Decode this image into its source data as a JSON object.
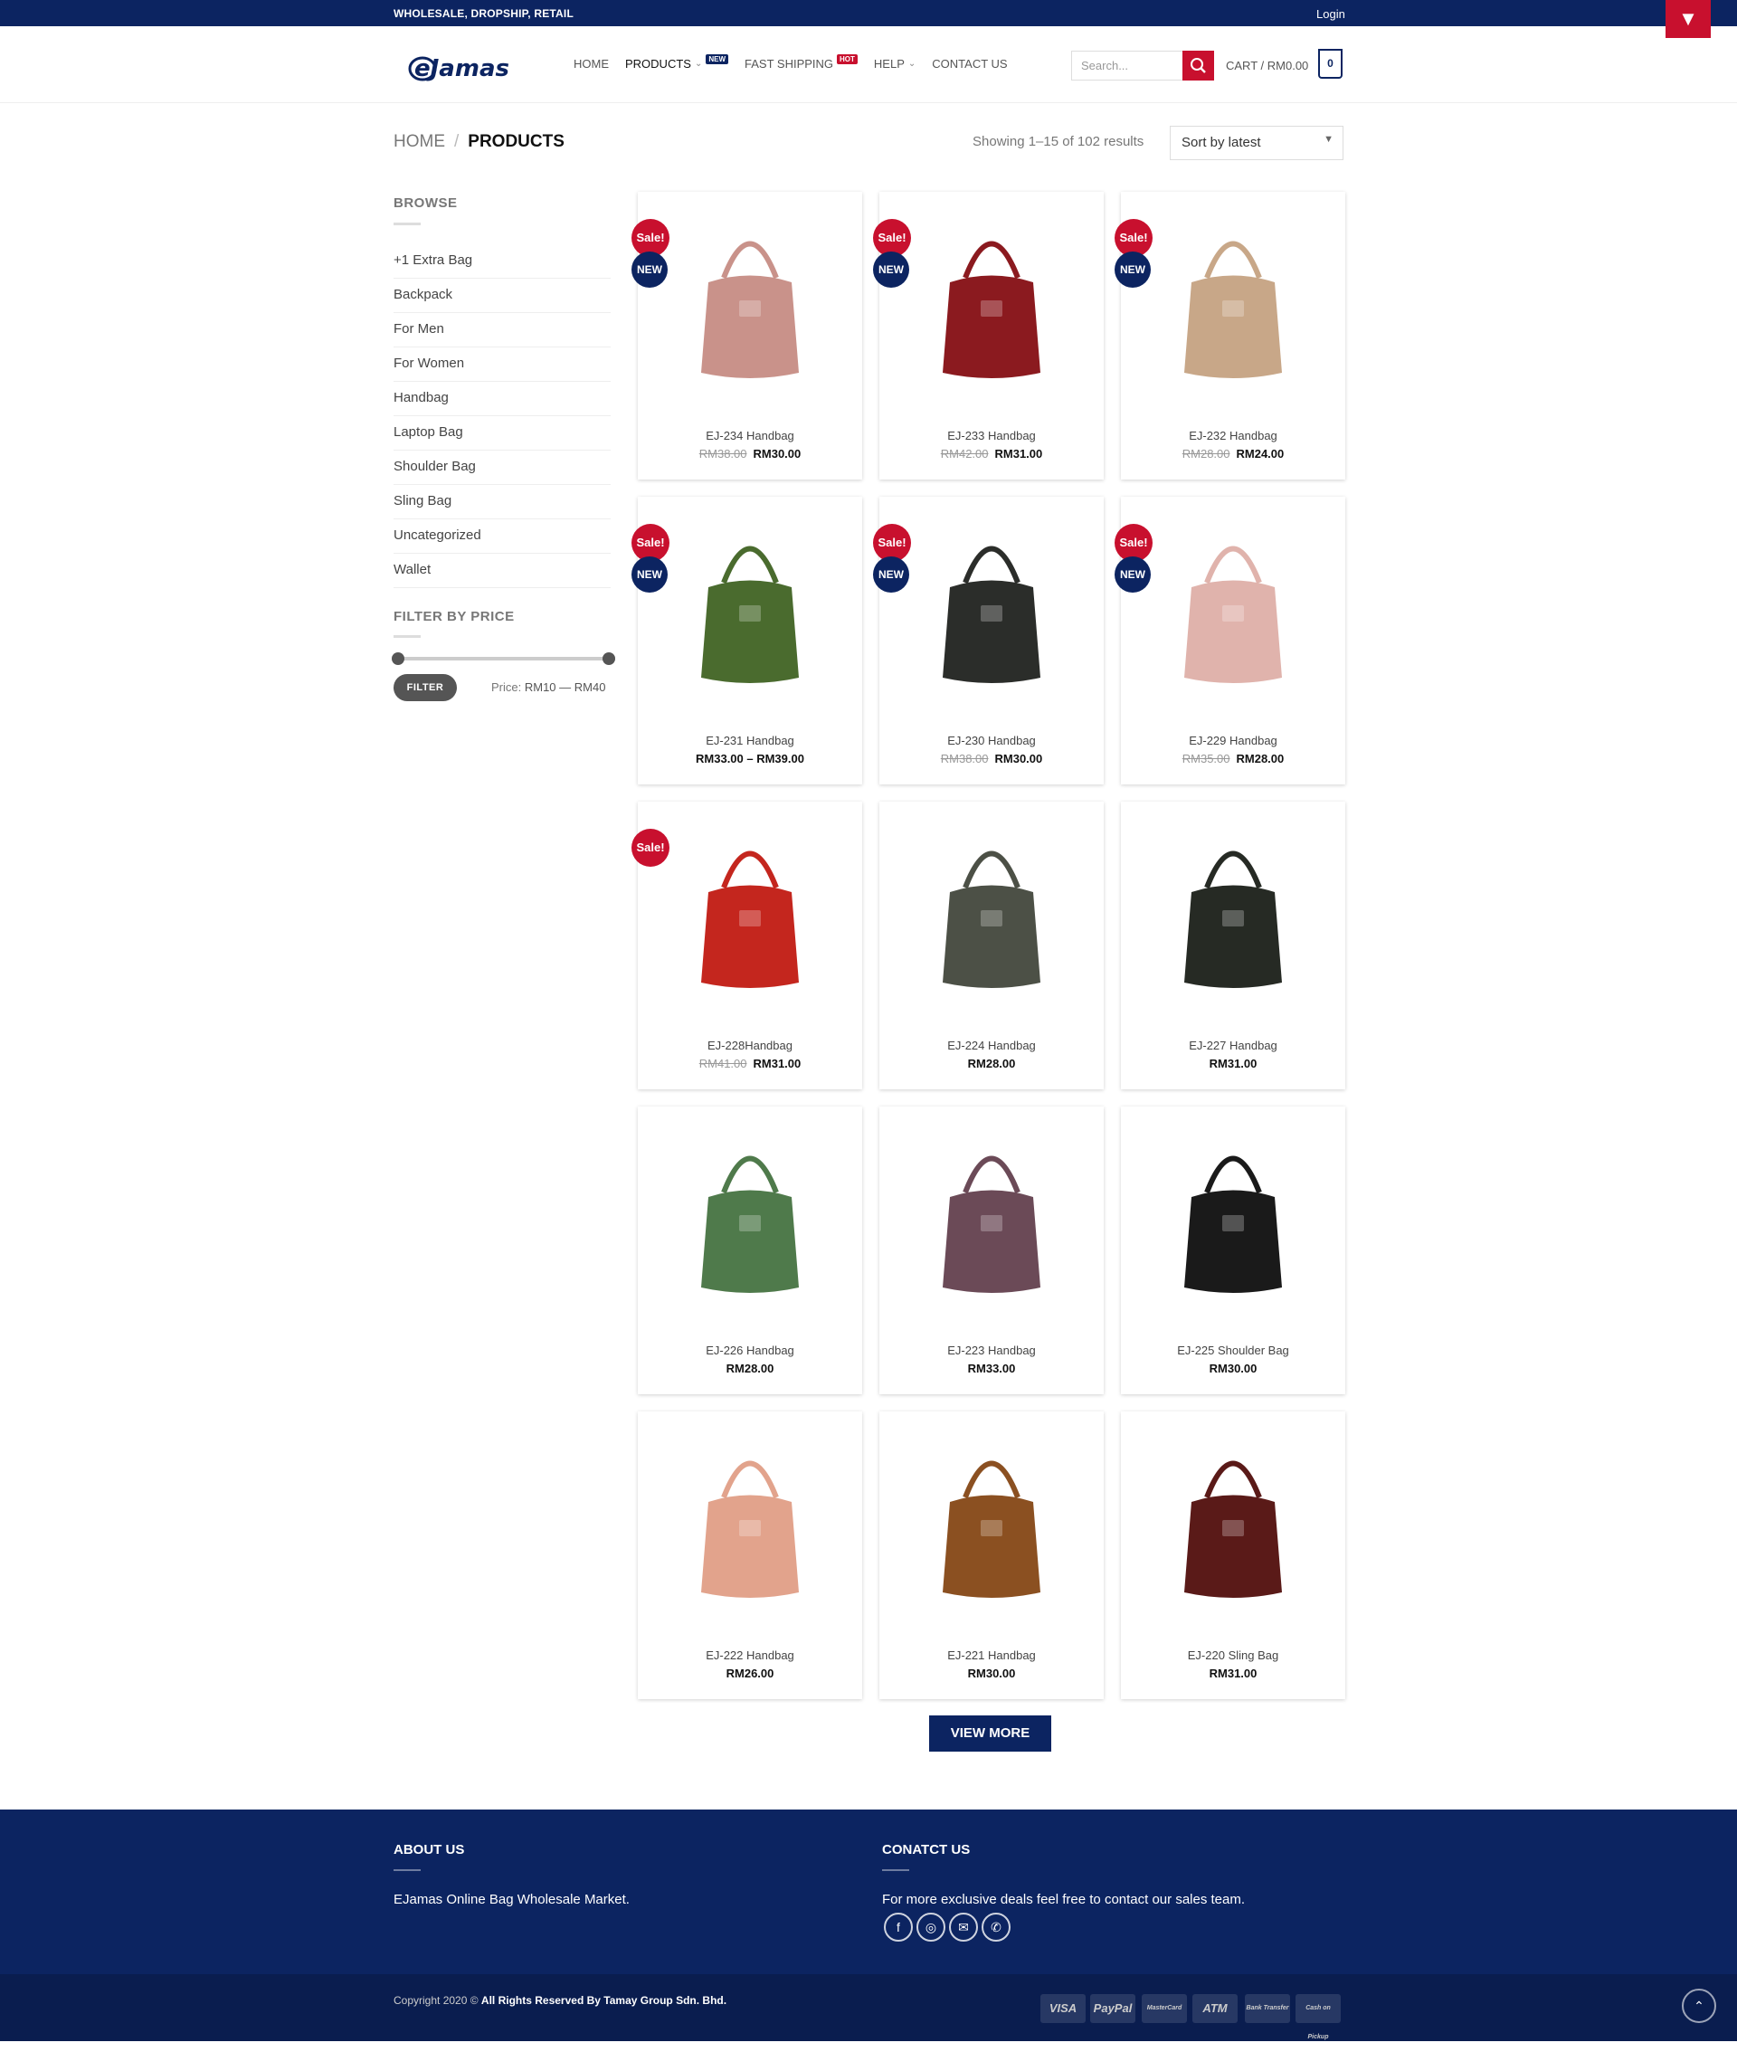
{
  "topbar": {
    "tagline": "WHOLESALE, DROPSHIP, RETAIL",
    "login": "Login",
    "corner_icon": "▼"
  },
  "header": {
    "logo_text": "eJamas",
    "nav": [
      {
        "label": "HOME",
        "chevron": false,
        "badge": ""
      },
      {
        "label": "PRODUCTS",
        "chevron": true,
        "badge": "NEW"
      },
      {
        "label": "FAST SHIPPING",
        "chevron": false,
        "badge": "HOT"
      },
      {
        "label": "HELP",
        "chevron": true,
        "badge": ""
      },
      {
        "label": "CONTACT US",
        "chevron": false,
        "badge": ""
      }
    ],
    "search_placeholder": "Search...",
    "cart_label": "CART / RM0.00",
    "cart_count": "0"
  },
  "breadcrumb": {
    "home": "HOME",
    "separator": "/",
    "current": "PRODUCTS"
  },
  "results": {
    "showing": "Showing 1–15 of 102 results",
    "sort": "Sort by latest"
  },
  "sidebar": {
    "browse_title": "BROWSE",
    "categories": [
      "+1 Extra Bag",
      "Backpack",
      "For Men",
      "For Women",
      "Handbag",
      "Laptop Bag",
      "Shoulder Bag",
      "Sling Bag",
      "Uncategorized",
      "Wallet"
    ],
    "filter_title": "FILTER BY PRICE",
    "filter_button": "FILTER",
    "price_label": "Price:",
    "price_range": "RM10 — RM40"
  },
  "products": [
    {
      "name": "EJ-234 Handbag",
      "old": "RM38.00",
      "price": "RM30.00",
      "sale": true,
      "new": true,
      "color": "#c9928a"
    },
    {
      "name": "EJ-233 Handbag",
      "old": "RM42.00",
      "price": "RM31.00",
      "sale": true,
      "new": true,
      "color": "#8b1a1f"
    },
    {
      "name": "EJ-232 Handbag",
      "old": "RM28.00",
      "price": "RM24.00",
      "sale": true,
      "new": true,
      "color": "#c8a788"
    },
    {
      "name": "EJ-231 Handbag",
      "old": "",
      "price": "RM33.00 – RM39.00",
      "sale": true,
      "new": true,
      "color": "#4a6b2e"
    },
    {
      "name": "EJ-230 Handbag",
      "old": "RM38.00",
      "price": "RM30.00",
      "sale": true,
      "new": true,
      "color": "#2b2d2a"
    },
    {
      "name": "EJ-229 Handbag",
      "old": "RM35.00",
      "price": "RM28.00",
      "sale": true,
      "new": true,
      "color": "#e0b3ac"
    },
    {
      "name": "EJ-228Handbag",
      "old": "RM41.00",
      "price": "RM31.00",
      "sale": true,
      "new": false,
      "color": "#c4261e"
    },
    {
      "name": "EJ-224 Handbag",
      "old": "",
      "price": "RM28.00",
      "sale": false,
      "new": false,
      "color": "#4c5046"
    },
    {
      "name": "EJ-227 Handbag",
      "old": "",
      "price": "RM31.00",
      "sale": false,
      "new": false,
      "color": "#262a24"
    },
    {
      "name": "EJ-226 Handbag",
      "old": "",
      "price": "RM28.00",
      "sale": false,
      "new": false,
      "color": "#4f7a4b"
    },
    {
      "name": "EJ-223 Handbag",
      "old": "",
      "price": "RM33.00",
      "sale": false,
      "new": false,
      "color": "#6b4a57"
    },
    {
      "name": "EJ-225 Shoulder Bag",
      "old": "",
      "price": "RM30.00",
      "sale": false,
      "new": false,
      "color": "#1a1a1a"
    },
    {
      "name": "EJ-222 Handbag",
      "old": "",
      "price": "RM26.00",
      "sale": false,
      "new": false,
      "color": "#e2a38c"
    },
    {
      "name": "EJ-221 Handbag",
      "old": "",
      "price": "RM30.00",
      "sale": false,
      "new": false,
      "color": "#8b5021"
    },
    {
      "name": "EJ-220 Sling Bag",
      "old": "",
      "price": "RM31.00",
      "sale": false,
      "new": false,
      "color": "#5a1a18"
    }
  ],
  "badges": {
    "sale": "Sale!",
    "new": "NEW"
  },
  "view_more": "VIEW MORE",
  "footer": {
    "about_title": "ABOUT US",
    "about_text": "EJamas Online Bag Wholesale Market.",
    "contact_title": "CONATCT US",
    "contact_text": "For more exclusive deals feel free to contact our sales team.",
    "social": [
      "facebook-icon",
      "instagram-icon",
      "email-icon",
      "phone-icon"
    ]
  },
  "bottom": {
    "copyright": "Copyright 2020 ©",
    "rights": "All Rights Reserved By Tamay Group Sdn. Bhd.",
    "payments": [
      "VISA",
      "PayPal",
      "MasterCard",
      "ATM",
      "Bank Transfer",
      "Cash on Pickup"
    ]
  }
}
